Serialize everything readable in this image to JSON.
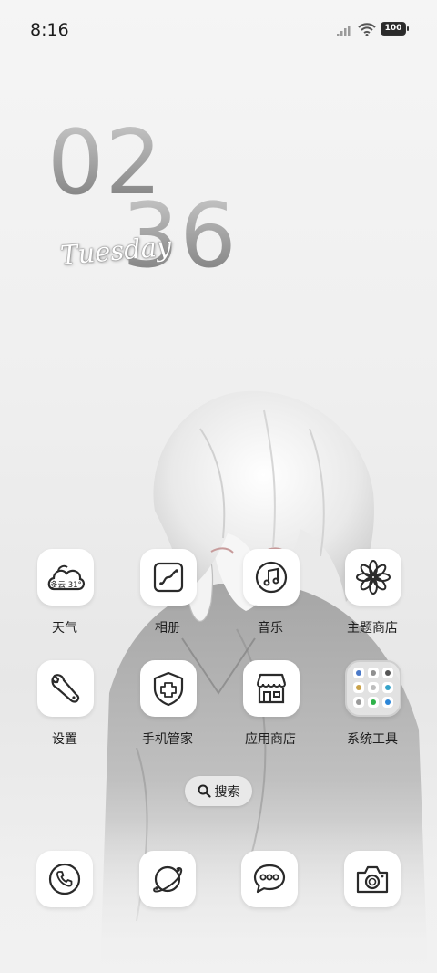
{
  "status_bar": {
    "time": "8:16",
    "battery": "100"
  },
  "clock": {
    "hours": "02",
    "minutes": "36",
    "day": "Tuesday"
  },
  "apps": {
    "weather": {
      "label": "天气",
      "icon_text": "多云 31°",
      "icon": "weather-cloud-icon"
    },
    "gallery": {
      "label": "相册",
      "icon": "gallery-icon"
    },
    "music": {
      "label": "音乐",
      "icon": "music-note-icon"
    },
    "themes": {
      "label": "主题商店",
      "icon": "flower-icon"
    },
    "settings": {
      "label": "设置",
      "icon": "wrench-icon"
    },
    "security": {
      "label": "手机管家",
      "icon": "shield-plus-icon"
    },
    "app_store": {
      "label": "应用商店",
      "icon": "storefront-icon"
    },
    "system_tools": {
      "label": "系统工具",
      "icon": "folder-icon"
    }
  },
  "search": {
    "label": "搜索",
    "icon": "search-icon"
  },
  "dock": {
    "phone": {
      "icon": "phone-icon"
    },
    "browser": {
      "icon": "browser-planet-icon"
    },
    "messages": {
      "icon": "message-bubble-icon"
    },
    "camera": {
      "icon": "camera-icon"
    }
  },
  "colors": {
    "background": "#efefef",
    "tile": "#ffffff",
    "icon_stroke": "#2a2a2a",
    "text": "#1e1e1e"
  }
}
